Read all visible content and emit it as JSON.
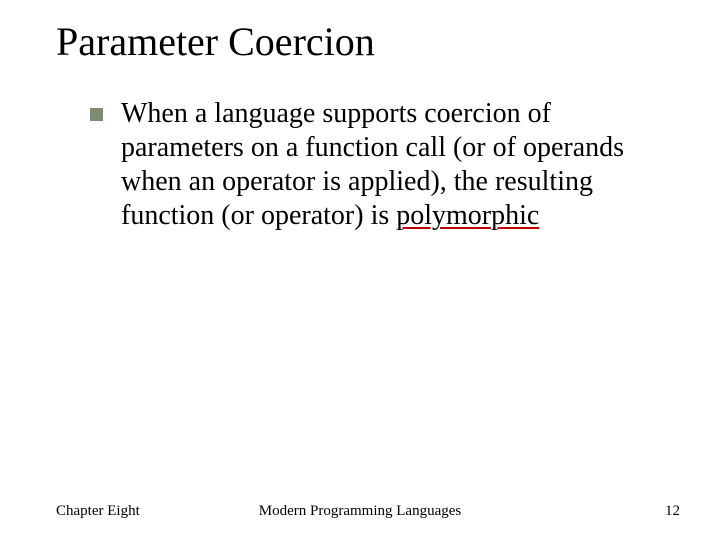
{
  "title": "Parameter Coercion",
  "body": {
    "bullet_text_before": "When a language supports coercion of parameters on a function call (or of operands when an operator is applied), the resulting function (or operator) is ",
    "bullet_text_emphasis": "polymorphic"
  },
  "footer": {
    "left": "Chapter Eight",
    "center": "Modern Programming Languages",
    "right": "12"
  }
}
